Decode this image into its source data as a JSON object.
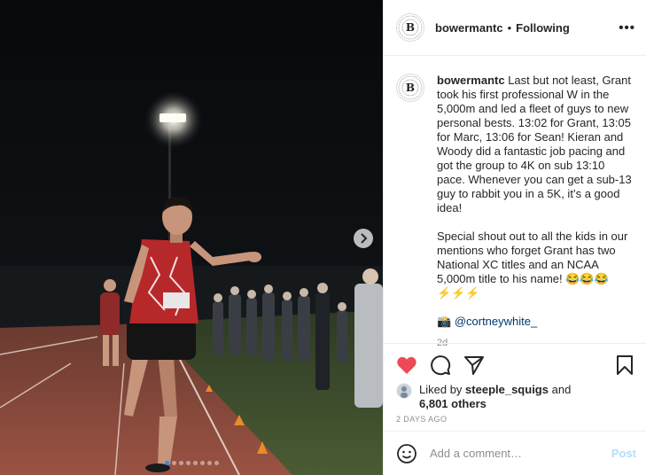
{
  "post": {
    "username": "bowermantc",
    "separator": "•",
    "follow_status": "Following",
    "more_glyph": "•••",
    "avatar_letter": "B",
    "caption": {
      "username": "bowermantc",
      "paragraph1": "Last but not least, Grant took his first professional W in the 5,000m and led a fleet of guys to new personal bests. 13:02 for Grant, 13:05 for Marc, 13:06 for Sean! Kieran and Woody did a fantastic job pacing and got the group to 4K on sub 13:10 pace. Whenever you can get a sub-13 guy to rabbit you in a 5K, it’s a good idea!",
      "paragraph2": "Special shout out to all the kids in our mentions who forget Grant has two National XC titles and an NCAA 5,000m title to his name! 😂😂😂 ⚡⚡⚡",
      "credit_prefix": "📸",
      "credit_mention": "@cortneywhite_",
      "time_ago": "2d"
    },
    "likes": {
      "prefix": "Liked by",
      "liker": "steeple_squigs",
      "conjunction": "and",
      "others": "6,801 others"
    },
    "posted_label": "2 DAYS AGO",
    "comment": {
      "placeholder": "Add a comment…",
      "post_label": "Post"
    },
    "carousel": {
      "total_slides": 8,
      "active_slide": 1
    },
    "colors": {
      "like_red": "#ed4956",
      "active_dot": "#2d8cf0",
      "post_disabled": "#b2dffc",
      "mention": "#00376b"
    },
    "icons": [
      "heart-icon",
      "comment-icon",
      "share-icon",
      "bookmark-icon",
      "emoji-icon",
      "chevron-right-icon",
      "more-icon"
    ]
  }
}
